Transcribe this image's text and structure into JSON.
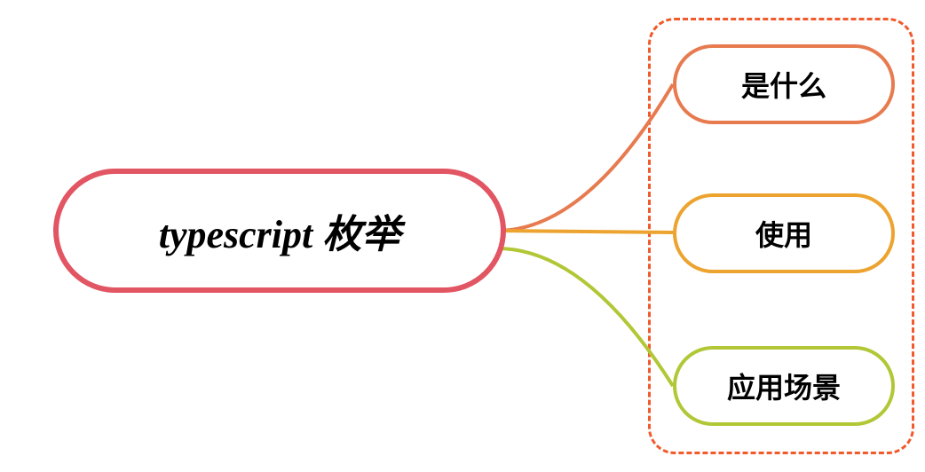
{
  "diagram": {
    "root": {
      "label": "typescript 枚举",
      "borderColor": "#e25563"
    },
    "container": {
      "borderColor": "#f15a2b"
    },
    "children": [
      {
        "label": "是什么",
        "color": "#e77b4f"
      },
      {
        "label": "使用",
        "color": "#eca32f"
      },
      {
        "label": "应用场景",
        "color": "#b2c736"
      }
    ]
  }
}
